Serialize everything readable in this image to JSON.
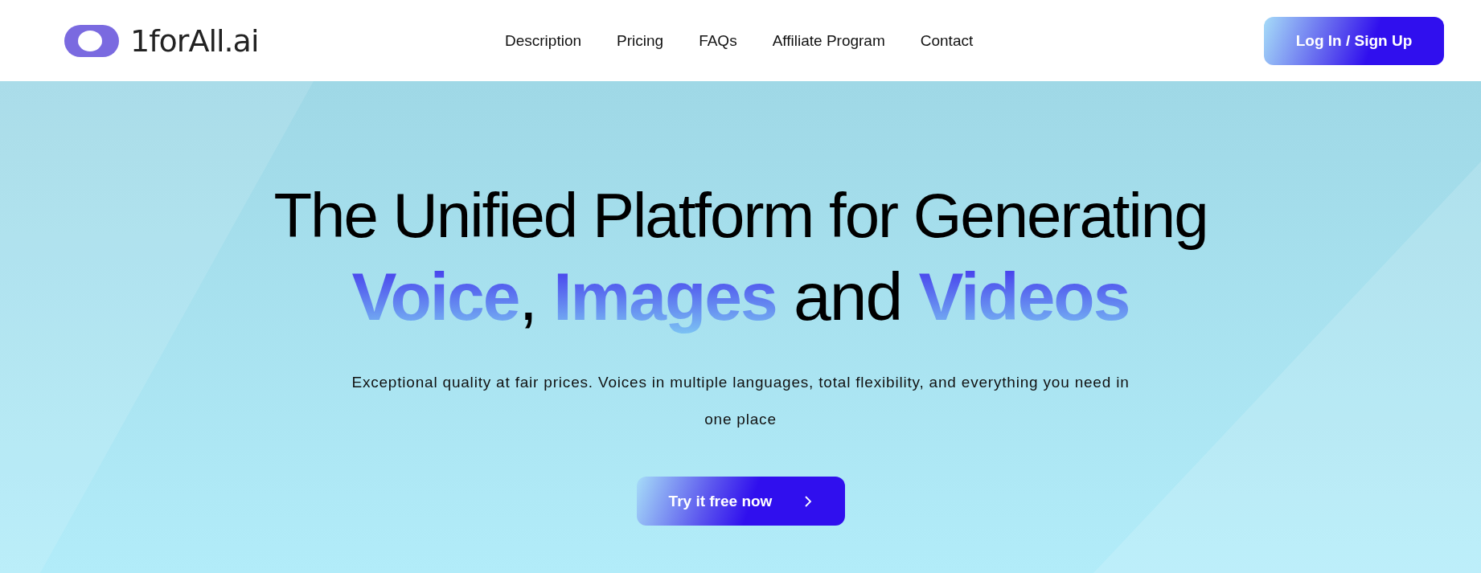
{
  "header": {
    "logo_text": "1forAll.ai",
    "nav": [
      {
        "label": "Description"
      },
      {
        "label": "Pricing"
      },
      {
        "label": "FAQs"
      },
      {
        "label": "Affiliate Program"
      },
      {
        "label": "Contact"
      }
    ],
    "login_button": "Log In / Sign Up"
  },
  "hero": {
    "title": "The Unified Platform for Generating",
    "subtitle_parts": [
      {
        "text": "Voice",
        "kind": "highlight"
      },
      {
        "text": ", ",
        "kind": "plain"
      },
      {
        "text": "Images",
        "kind": "highlight"
      },
      {
        "text": " and ",
        "kind": "plain"
      },
      {
        "text": "Videos",
        "kind": "highlight"
      }
    ],
    "description": "Exceptional quality at fair prices. Voices in multiple languages, total flexibility, and everything you need in one place",
    "cta_button": "Try it free now"
  }
}
